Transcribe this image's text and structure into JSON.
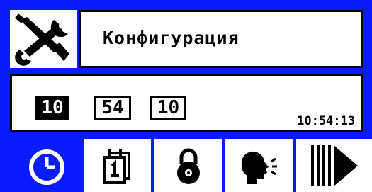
{
  "header": {
    "icon": "wrench-screwdriver-icon",
    "title": "Конфигурация"
  },
  "time_setting": {
    "hours": "10",
    "minutes": "54",
    "seconds": "10",
    "selected_field": "hours",
    "current_time": "10:54:13"
  },
  "toolbar": {
    "items": [
      {
        "icon": "clock-icon",
        "active": true
      },
      {
        "icon": "calendar-icon",
        "active": false
      },
      {
        "icon": "lock-icon",
        "active": false
      },
      {
        "icon": "voice-icon",
        "active": false
      },
      {
        "icon": "next-arrow-icon",
        "active": false
      }
    ]
  },
  "colors": {
    "background": "#0a1cff",
    "panel": "#ffffff",
    "foreground": "#000000",
    "active_tab": "#0a1cff"
  }
}
